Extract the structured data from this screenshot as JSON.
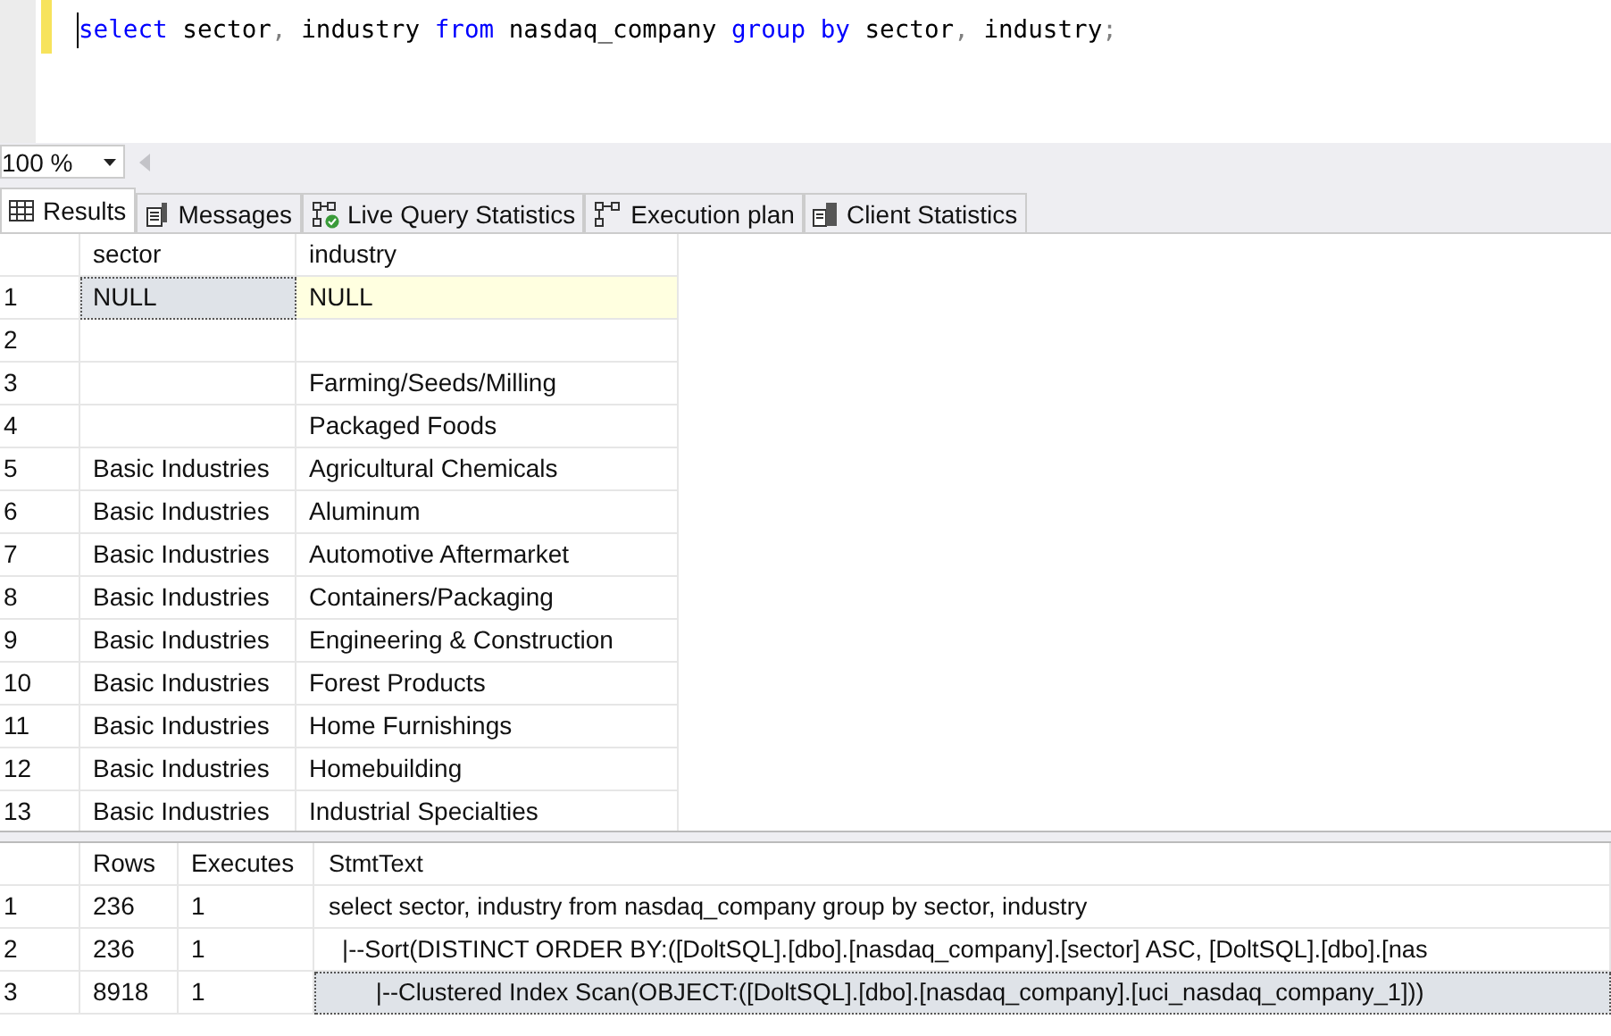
{
  "editor": {
    "tokens": [
      {
        "text": "select",
        "kind": "keyword"
      },
      {
        "text": "sector",
        "kind": "plain"
      },
      {
        "text": ",",
        "kind": "punct"
      },
      {
        "text": "industry",
        "kind": "plain"
      },
      {
        "text": "from",
        "kind": "keyword"
      },
      {
        "text": "nasdaq_company",
        "kind": "plain"
      },
      {
        "text": "group",
        "kind": "keyword"
      },
      {
        "text": "by",
        "kind": "keyword"
      },
      {
        "text": "sector",
        "kind": "plain"
      },
      {
        "text": ",",
        "kind": "punct"
      },
      {
        "text": "industry",
        "kind": "plain"
      },
      {
        "text": ";",
        "kind": "punct"
      }
    ]
  },
  "zoom": {
    "value": "100 %"
  },
  "tabs": [
    {
      "label": "Results",
      "selected": true
    },
    {
      "label": "Messages",
      "selected": false
    },
    {
      "label": "Live Query Statistics",
      "selected": false
    },
    {
      "label": "Execution plan",
      "selected": false
    },
    {
      "label": "Client Statistics",
      "selected": false
    }
  ],
  "results_grid": {
    "columns": [
      "sector",
      "industry"
    ],
    "rows": [
      {
        "number": "1",
        "cells": [
          {
            "text": "NULL",
            "selected": true,
            "highlighted": false
          },
          {
            "text": "NULL",
            "selected": false,
            "highlighted": true
          }
        ]
      },
      {
        "number": "2",
        "cells": [
          {
            "selected": false,
            "highlighted": false
          },
          {
            "selected": false,
            "highlighted": false
          }
        ]
      },
      {
        "number": "3",
        "cells": [
          {
            "selected": false,
            "highlighted": false
          },
          {
            "text": "Farming/Seeds/Milling",
            "selected": false,
            "highlighted": false
          }
        ]
      },
      {
        "number": "4",
        "cells": [
          {
            "selected": false,
            "highlighted": false
          },
          {
            "text": "Packaged Foods",
            "selected": false,
            "highlighted": false
          }
        ]
      },
      {
        "number": "5",
        "cells": [
          {
            "text": "Basic Industries",
            "selected": false,
            "highlighted": false
          },
          {
            "text": "Agricultural Chemicals",
            "selected": false,
            "highlighted": false
          }
        ]
      },
      {
        "number": "6",
        "cells": [
          {
            "text": "Basic Industries",
            "selected": false,
            "highlighted": false
          },
          {
            "text": "Aluminum",
            "selected": false,
            "highlighted": false
          }
        ]
      },
      {
        "number": "7",
        "cells": [
          {
            "text": "Basic Industries",
            "selected": false,
            "highlighted": false
          },
          {
            "text": "Automotive Aftermarket",
            "selected": false,
            "highlighted": false
          }
        ]
      },
      {
        "number": "8",
        "cells": [
          {
            "text": "Basic Industries",
            "selected": false,
            "highlighted": false
          },
          {
            "text": "Containers/Packaging",
            "selected": false,
            "highlighted": false
          }
        ]
      },
      {
        "number": "9",
        "cells": [
          {
            "text": "Basic Industries",
            "selected": false,
            "highlighted": false
          },
          {
            "text": "Engineering & Construction",
            "selected": false,
            "highlighted": false
          }
        ]
      },
      {
        "number": "10",
        "cells": [
          {
            "text": "Basic Industries",
            "selected": false,
            "highlighted": false
          },
          {
            "text": "Forest Products",
            "selected": false,
            "highlighted": false
          }
        ]
      },
      {
        "number": "11",
        "cells": [
          {
            "text": "Basic Industries",
            "selected": false,
            "highlighted": false
          },
          {
            "text": "Home Furnishings",
            "selected": false,
            "highlighted": false
          }
        ]
      },
      {
        "number": "12",
        "cells": [
          {
            "text": "Basic Industries",
            "selected": false,
            "highlighted": false
          },
          {
            "text": "Homebuilding",
            "selected": false,
            "highlighted": false
          }
        ]
      },
      {
        "number": "13",
        "cells": [
          {
            "text": "Basic Industries",
            "selected": false,
            "highlighted": false
          },
          {
            "text": "Industrial Specialties",
            "selected": false,
            "highlighted": false
          }
        ]
      }
    ]
  },
  "plan_grid": {
    "columns": [
      "Rows",
      "Executes",
      "StmtText"
    ],
    "rows": [
      {
        "number": "1",
        "cells": [
          {
            "text": "236",
            "selected": false
          },
          {
            "text": "1",
            "selected": false
          },
          {
            "text": "select sector, industry from nasdaq_company group by sector, industry",
            "selected": false
          }
        ]
      },
      {
        "number": "2",
        "cells": [
          {
            "text": "236",
            "selected": false
          },
          {
            "text": "1",
            "selected": false
          },
          {
            "text": "  |--Sort(DISTINCT ORDER BY:([DoltSQL].[dbo].[nasdaq_company].[sector] ASC, [DoltSQL].[dbo].[nas",
            "selected": false
          }
        ]
      },
      {
        "number": "3",
        "cells": [
          {
            "text": "8918",
            "selected": false
          },
          {
            "text": "1",
            "selected": false
          },
          {
            "text": "       |--Clustered Index Scan(OBJECT:([DoltSQL].[dbo].[nasdaq_company].[uci_nasdaq_company_1]))",
            "selected": true
          }
        ]
      }
    ]
  }
}
